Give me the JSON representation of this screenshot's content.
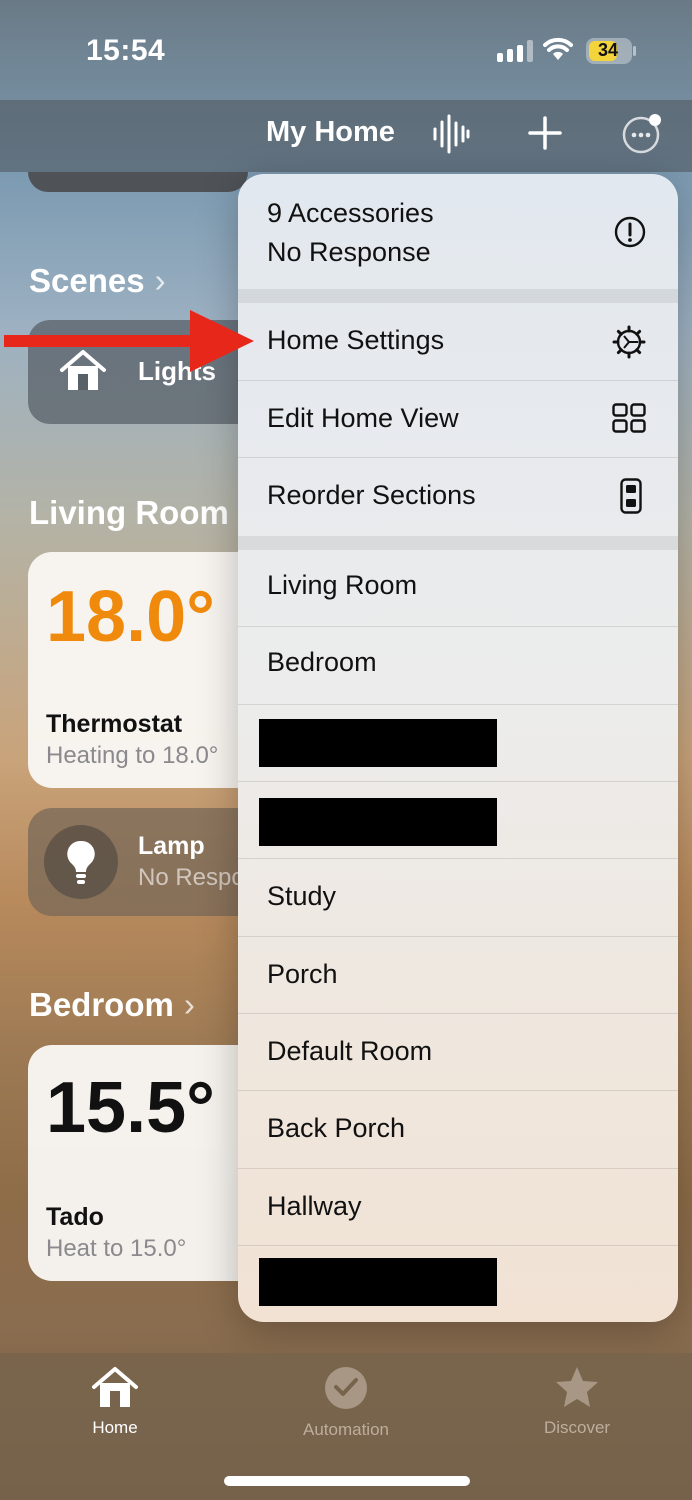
{
  "status_bar": {
    "time": "15:54",
    "battery": "34"
  },
  "nav": {
    "title": "My Home",
    "icons": [
      "waveform-icon",
      "plus-icon",
      "more-icon"
    ]
  },
  "background": {
    "scenes_title": "Scenes",
    "scene_label": "Lights",
    "living_room_title": "Living Room",
    "thermostat": {
      "temp": "18.0°",
      "name": "Thermostat",
      "status": "Heating to 18.0°"
    },
    "lamp": {
      "name": "Lamp",
      "status": "No Response"
    },
    "bedroom_title": "Bedroom",
    "tado": {
      "temp": "15.5°",
      "name": "Tado",
      "status": "Heat to 15.0°"
    }
  },
  "menu": {
    "alert": {
      "line1": "9 Accessories",
      "line2": "No Response"
    },
    "actions": [
      "Home Settings",
      "Edit Home View",
      "Reorder Sections"
    ],
    "rooms": [
      "Living Room",
      "Bedroom",
      "Study",
      "Porch",
      "Default Room",
      "Back Porch",
      "Hallway"
    ]
  },
  "tabs": [
    {
      "label": "Home",
      "active": true
    },
    {
      "label": "Automation",
      "active": false
    },
    {
      "label": "Discover",
      "active": false
    }
  ],
  "colors": {
    "accent_temp": "#f08a0c",
    "annotation_arrow": "#e8271b"
  }
}
